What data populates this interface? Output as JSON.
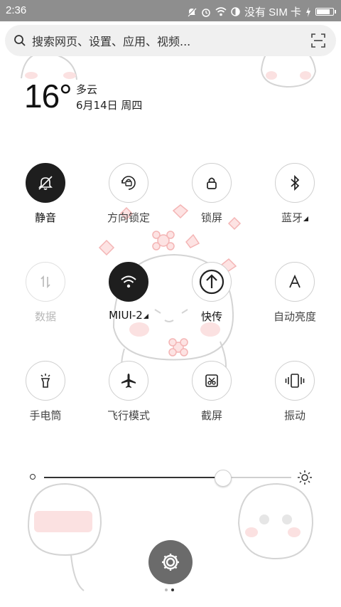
{
  "status_bar": {
    "time": "2:36",
    "sim_text": "没有 SIM 卡",
    "battery_level": 0.85,
    "icons": [
      "mute-icon",
      "alarm-icon",
      "wifi-icon",
      "data-saver-icon",
      "charging-icon",
      "battery-icon"
    ]
  },
  "search": {
    "placeholder": "搜索网页、设置、应用、视频...",
    "icons": [
      "search-icon",
      "scan-icon"
    ]
  },
  "weather": {
    "temperature": "16°",
    "condition": "多云",
    "date": "6月14日 周四"
  },
  "toggles": [
    {
      "label": "静音",
      "icon": "mute-icon",
      "state": "on"
    },
    {
      "label": "方向锁定",
      "icon": "rotation-lock-icon",
      "state": "off"
    },
    {
      "label": "锁屏",
      "icon": "lock-icon",
      "state": "off"
    },
    {
      "label": "蓝牙",
      "icon": "bluetooth-icon",
      "state": "off",
      "has_menu": true
    },
    {
      "label": "数据",
      "icon": "mobile-data-icon",
      "state": "disabled"
    },
    {
      "label": "MIUI-2",
      "icon": "wifi-icon",
      "state": "on",
      "has_menu": true
    },
    {
      "label": "快传",
      "icon": "share-upload-icon",
      "state": "off"
    },
    {
      "label": "自动亮度",
      "icon": "auto-brightness-icon",
      "state": "off"
    },
    {
      "label": "手电筒",
      "icon": "flashlight-icon",
      "state": "off"
    },
    {
      "label": "飞行模式",
      "icon": "airplane-icon",
      "state": "off"
    },
    {
      "label": "截屏",
      "icon": "screenshot-icon",
      "state": "off"
    },
    {
      "label": "振动",
      "icon": "vibrate-icon",
      "state": "off"
    }
  ],
  "brightness": {
    "level": 0.72,
    "icons": [
      "brightness-low-icon",
      "brightness-high-icon"
    ]
  },
  "settings_button": {
    "icon": "gear-icon"
  },
  "pager": {
    "count": 2,
    "active": 1
  },
  "colors": {
    "status_bar": "#8e8e8e",
    "toggle_on": "#1e1e1e",
    "fab": "#6b6b6b",
    "accent_pink": "#f4a5a5"
  }
}
